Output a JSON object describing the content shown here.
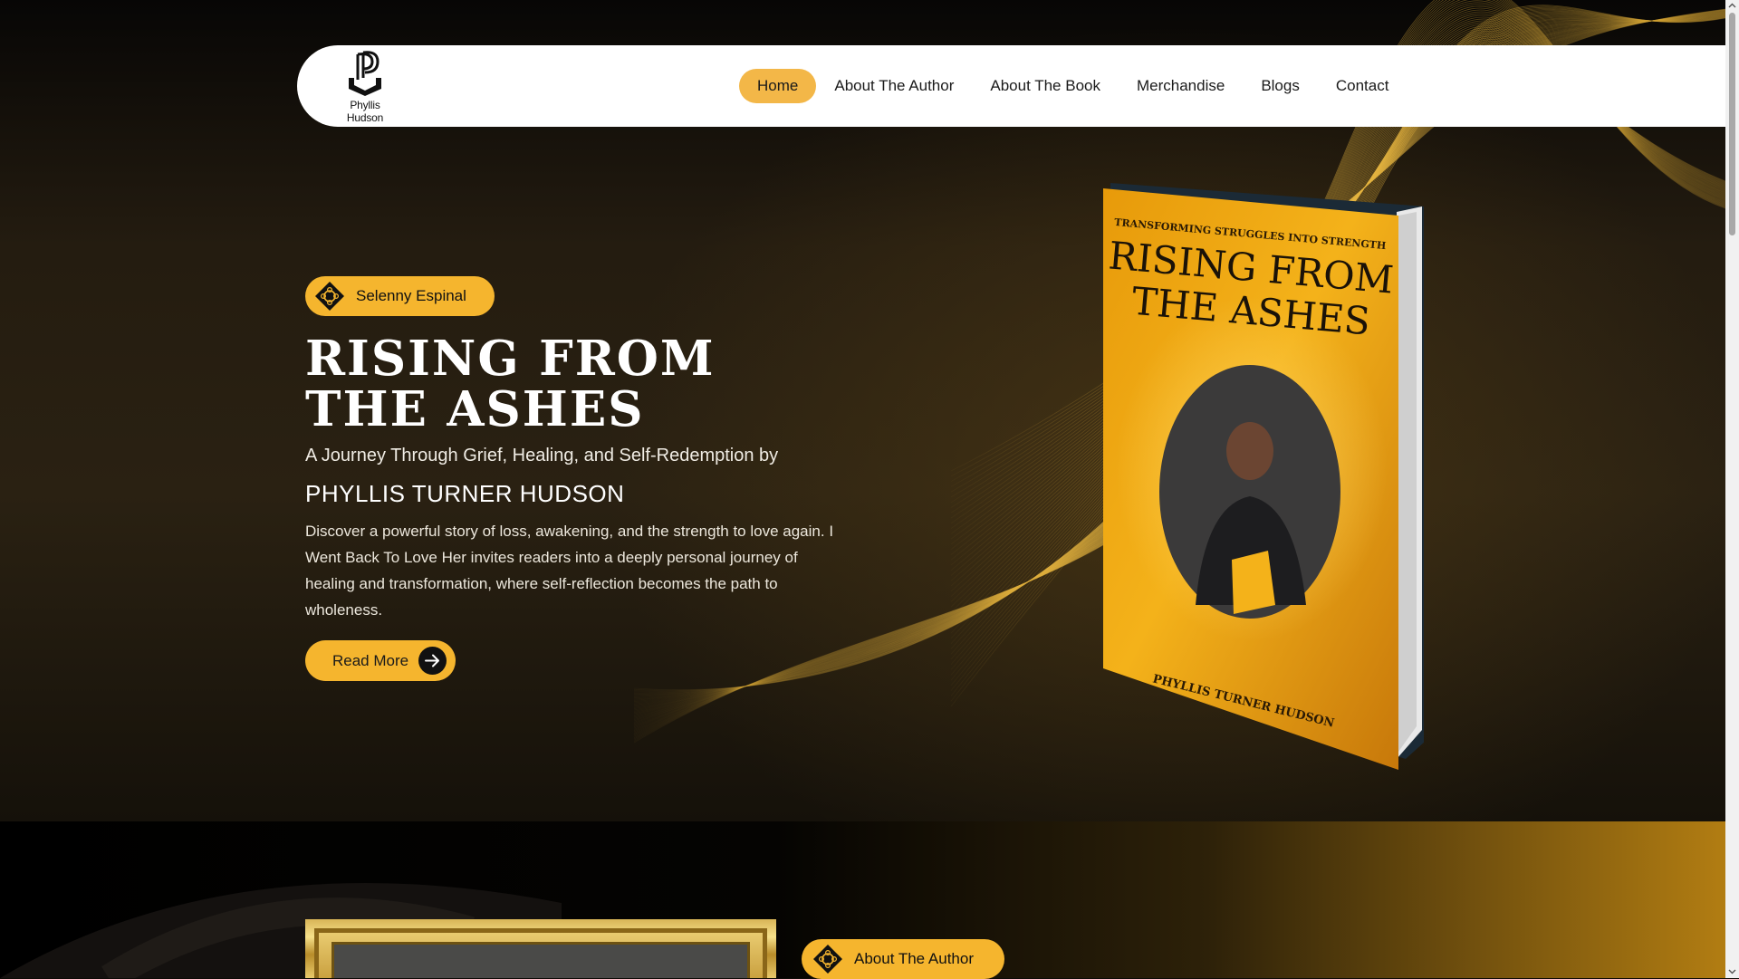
{
  "brand": {
    "logo_text": "Phyllis Hudson"
  },
  "nav": {
    "items": [
      {
        "label": "Home",
        "active": true
      },
      {
        "label": "About The Author",
        "active": false
      },
      {
        "label": "About The Book",
        "active": false
      },
      {
        "label": "Merchandise",
        "active": false
      },
      {
        "label": "Blogs",
        "active": false
      },
      {
        "label": "Contact",
        "active": false
      }
    ]
  },
  "hero": {
    "tag": "Selenny Espinal",
    "title_line1": "RISING FROM",
    "title_line2": "THE ASHES",
    "subtitle": "A Journey Through Grief, Healing, and Self-Redemption by",
    "author": "PHYLLIS TURNER HUDSON",
    "description": "Discover a powerful story of loss, awakening, and the strength to love again. I Went Back To Love Her invites readers into a deeply personal journey of healing and transformation, where self-reflection becomes the path to wholeness.",
    "cta": "Read More"
  },
  "book_cover": {
    "tagline": "TRANSFORMING STRUGGLES INTO STRENGTH",
    "title_line1": "RISING FROM",
    "title_line2": "THE ASHES",
    "author": "PHYLLIS TURNER HUDSON"
  },
  "about_section": {
    "tag": "About The Author"
  },
  "colors": {
    "accent": "#f5b52e",
    "nav_active": "#f3b748",
    "dark": "#111111"
  }
}
